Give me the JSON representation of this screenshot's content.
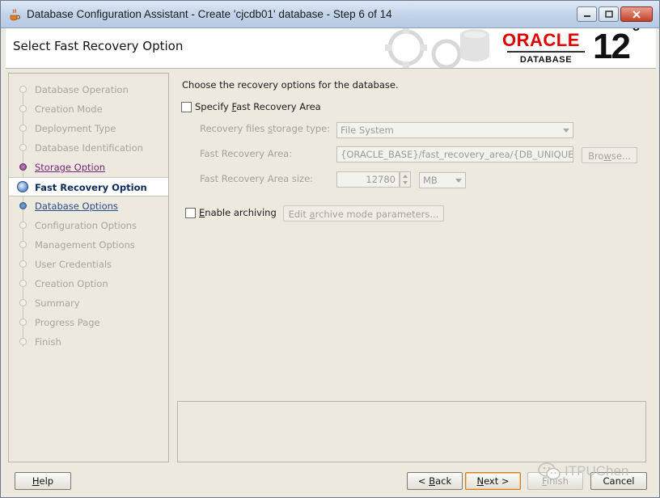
{
  "window": {
    "title": "Database Configuration Assistant - Create 'cjcdb01' database - Step 6 of 14"
  },
  "banner": {
    "title": "Select Fast Recovery Option",
    "logo_oracle": "ORACLE",
    "logo_database": "DATABASE",
    "logo_version": "12",
    "logo_version_suffix": "c"
  },
  "nav": {
    "items": [
      {
        "label": "Database Operation",
        "state": "disabled"
      },
      {
        "label": "Creation Mode",
        "state": "disabled"
      },
      {
        "label": "Deployment Type",
        "state": "disabled"
      },
      {
        "label": "Database Identification",
        "state": "disabled"
      },
      {
        "label": "Storage Option",
        "state": "visited"
      },
      {
        "label": "Fast Recovery Option",
        "state": "current"
      },
      {
        "label": "Database Options",
        "state": "link"
      },
      {
        "label": "Configuration Options",
        "state": "disabled"
      },
      {
        "label": "Management Options",
        "state": "disabled"
      },
      {
        "label": "User Credentials",
        "state": "disabled"
      },
      {
        "label": "Creation Option",
        "state": "disabled"
      },
      {
        "label": "Summary",
        "state": "disabled"
      },
      {
        "label": "Progress Page",
        "state": "disabled"
      },
      {
        "label": "Finish",
        "state": "disabled"
      }
    ]
  },
  "main": {
    "intro": "Choose the recovery options for the database.",
    "fra_checkbox": {
      "pre": "Specify ",
      "mnemonic": "F",
      "post": "ast Recovery Area",
      "checked": false
    },
    "storage_type": {
      "label_pre": "Recovery files ",
      "label_mnemonic": "s",
      "label_post": "torage type:",
      "value": "File System"
    },
    "fra_location": {
      "label": "Fast Recovery Area:",
      "value": "{ORACLE_BASE}/fast_recovery_area/{DB_UNIQUE_",
      "browse_pre": "Bro",
      "browse_mnemonic": "w",
      "browse_post": "se..."
    },
    "fra_size": {
      "label": "Fast Recovery Area size:",
      "value": "12780",
      "unit": "MB"
    },
    "archiving_checkbox": {
      "pre": "",
      "mnemonic": "E",
      "post": "nable archiving",
      "checked": false
    },
    "archive_button": {
      "pre": "Edit ",
      "mnemonic": "a",
      "post": "rchive mode parameters..."
    }
  },
  "footer": {
    "help": {
      "mnemonic": "H",
      "post": "elp"
    },
    "back": {
      "pre": "< ",
      "mnemonic": "B",
      "post": "ack"
    },
    "next": {
      "pre": "",
      "mnemonic": "N",
      "post": "ext >"
    },
    "finish": {
      "mnemonic": "F",
      "post": "inish"
    },
    "cancel": "Cancel"
  },
  "watermark": {
    "text": "ITPUChen"
  },
  "colors": {
    "oracle_red": "#e00000",
    "window_bg": "#eceadf",
    "link": "#2a4a8e",
    "visited": "#7a1f7a",
    "current_nav_text": "#0d2a5c",
    "default_button_border": "#c87f2e"
  }
}
